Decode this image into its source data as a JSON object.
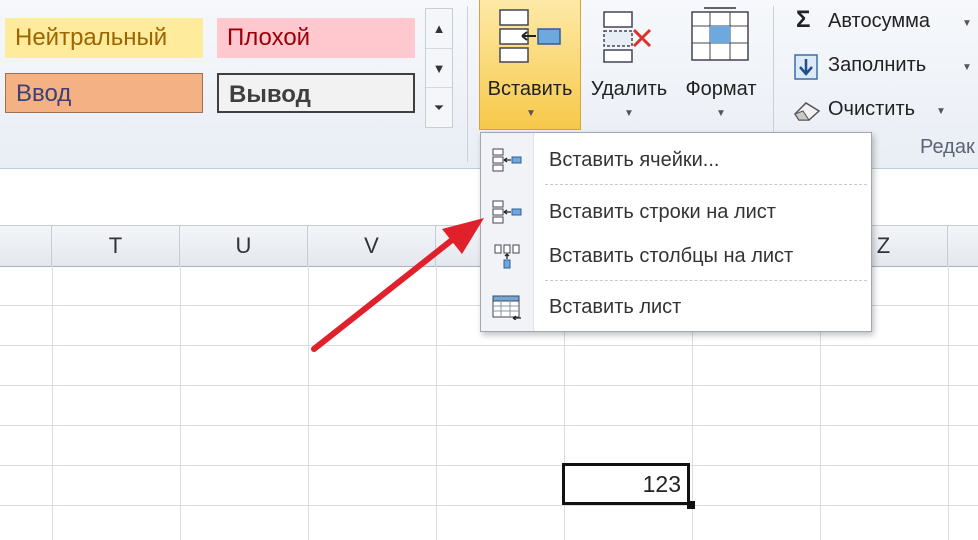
{
  "styles": {
    "neutral": "Нейтральный",
    "bad": "Плохой",
    "input": "Ввод",
    "output": "Вывод"
  },
  "gallery_scroll": {
    "up": "▲",
    "down": "▼",
    "more": "⏷"
  },
  "cells_group": {
    "insert": "Вставить",
    "delete": "Удалить",
    "format": "Формат"
  },
  "editing_group": {
    "autosum": "Автосумма",
    "fill": "Заполнить",
    "clear": "Очистить",
    "group_label": "Редак"
  },
  "caret": "▼",
  "columns": [
    "T",
    "U",
    "V",
    "Z"
  ],
  "active_cell_value": "123",
  "insert_menu": {
    "items": [
      {
        "label": "Вставить ячейки...",
        "icon": "insert-cells-icon"
      },
      {
        "label": "Вставить строки на лист",
        "icon": "insert-rows-icon"
      },
      {
        "label": "Вставить столбцы на лист",
        "icon": "insert-columns-icon"
      },
      {
        "label": "Вставить лист",
        "icon": "insert-sheet-icon"
      }
    ]
  },
  "colors": {
    "arrow": "#e0202a",
    "insert_highlight": "#f7c94a",
    "neutral_fill": "#ffeb9c",
    "bad_fill": "#ffc7ce",
    "input_fill": "#f4b183"
  }
}
